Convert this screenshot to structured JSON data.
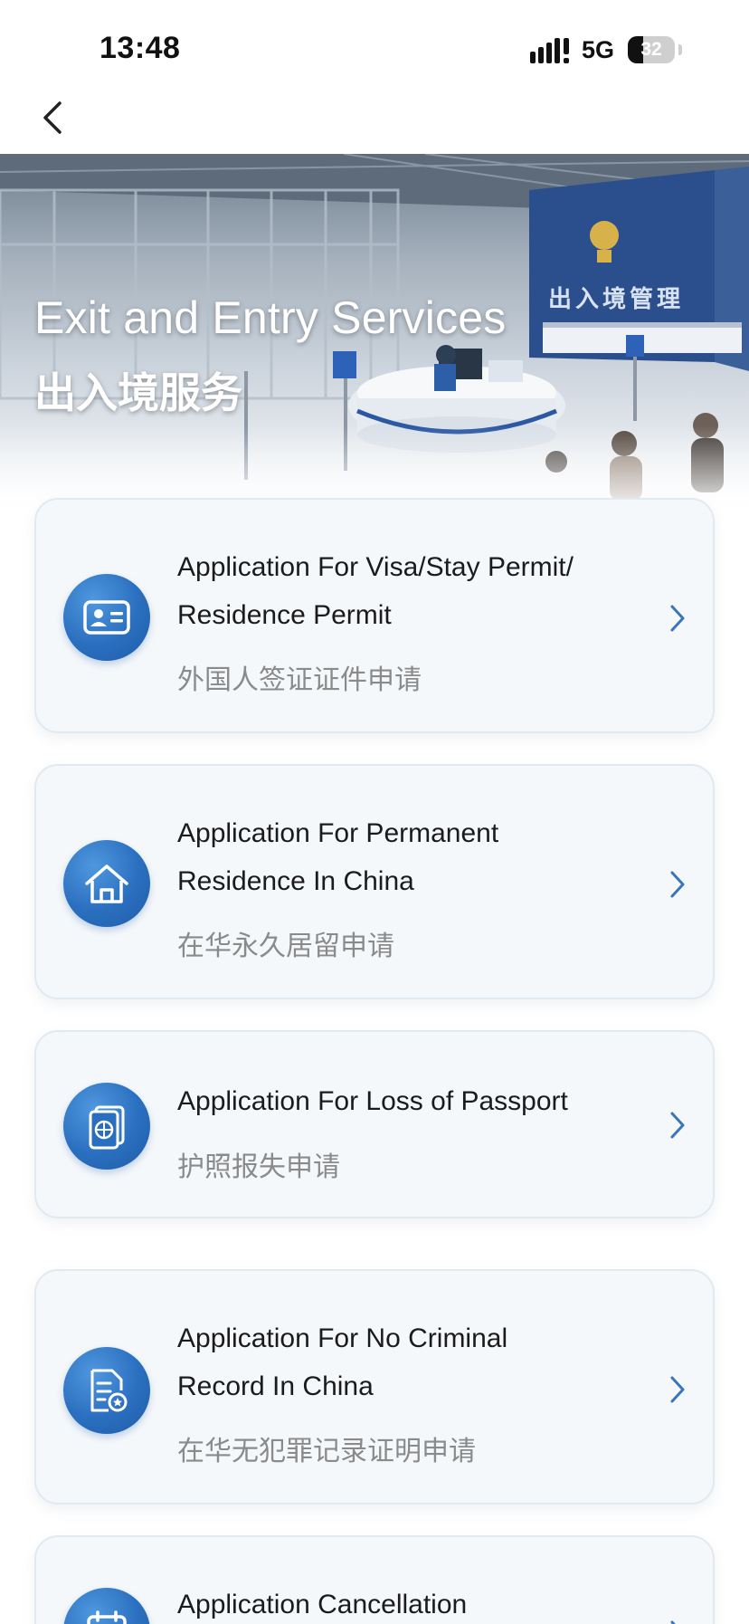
{
  "status_bar": {
    "time": "13:48",
    "network": "5G",
    "battery_level": "32",
    "battery_fraction": 0.32
  },
  "nav": {
    "back_icon": "chevron-left-icon"
  },
  "hero": {
    "title_en": "Exit and Entry Services",
    "title_zh": "出入境服务",
    "background_sign": "出入境管理"
  },
  "services": [
    {
      "title_line1": "Application For Visa/Stay Permit/",
      "title_line2": "Residence Permit",
      "subtitle": "外国人签证证件申请",
      "icon": "id-card-icon"
    },
    {
      "title_line1": "Application For Permanent",
      "title_line2": "Residence In China",
      "subtitle": "在华永久居留申请",
      "icon": "house-icon"
    },
    {
      "title_line1": "Application For Loss of Passport",
      "subtitle": "护照报失申请",
      "icon": "passport-icon"
    },
    {
      "title_line1": "Application For No Criminal",
      "title_line2": "Record In China",
      "subtitle": "在华无犯罪记录证明申请",
      "icon": "certificate-document-icon"
    },
    {
      "title_line1": "Application Cancellation",
      "icon": "calendar-icon"
    }
  ],
  "colors": {
    "accent": "#2a6fbf",
    "card_bg": "#f5f8fb",
    "subtitle": "#8a8a8a",
    "chevron": "#3b74b8"
  }
}
